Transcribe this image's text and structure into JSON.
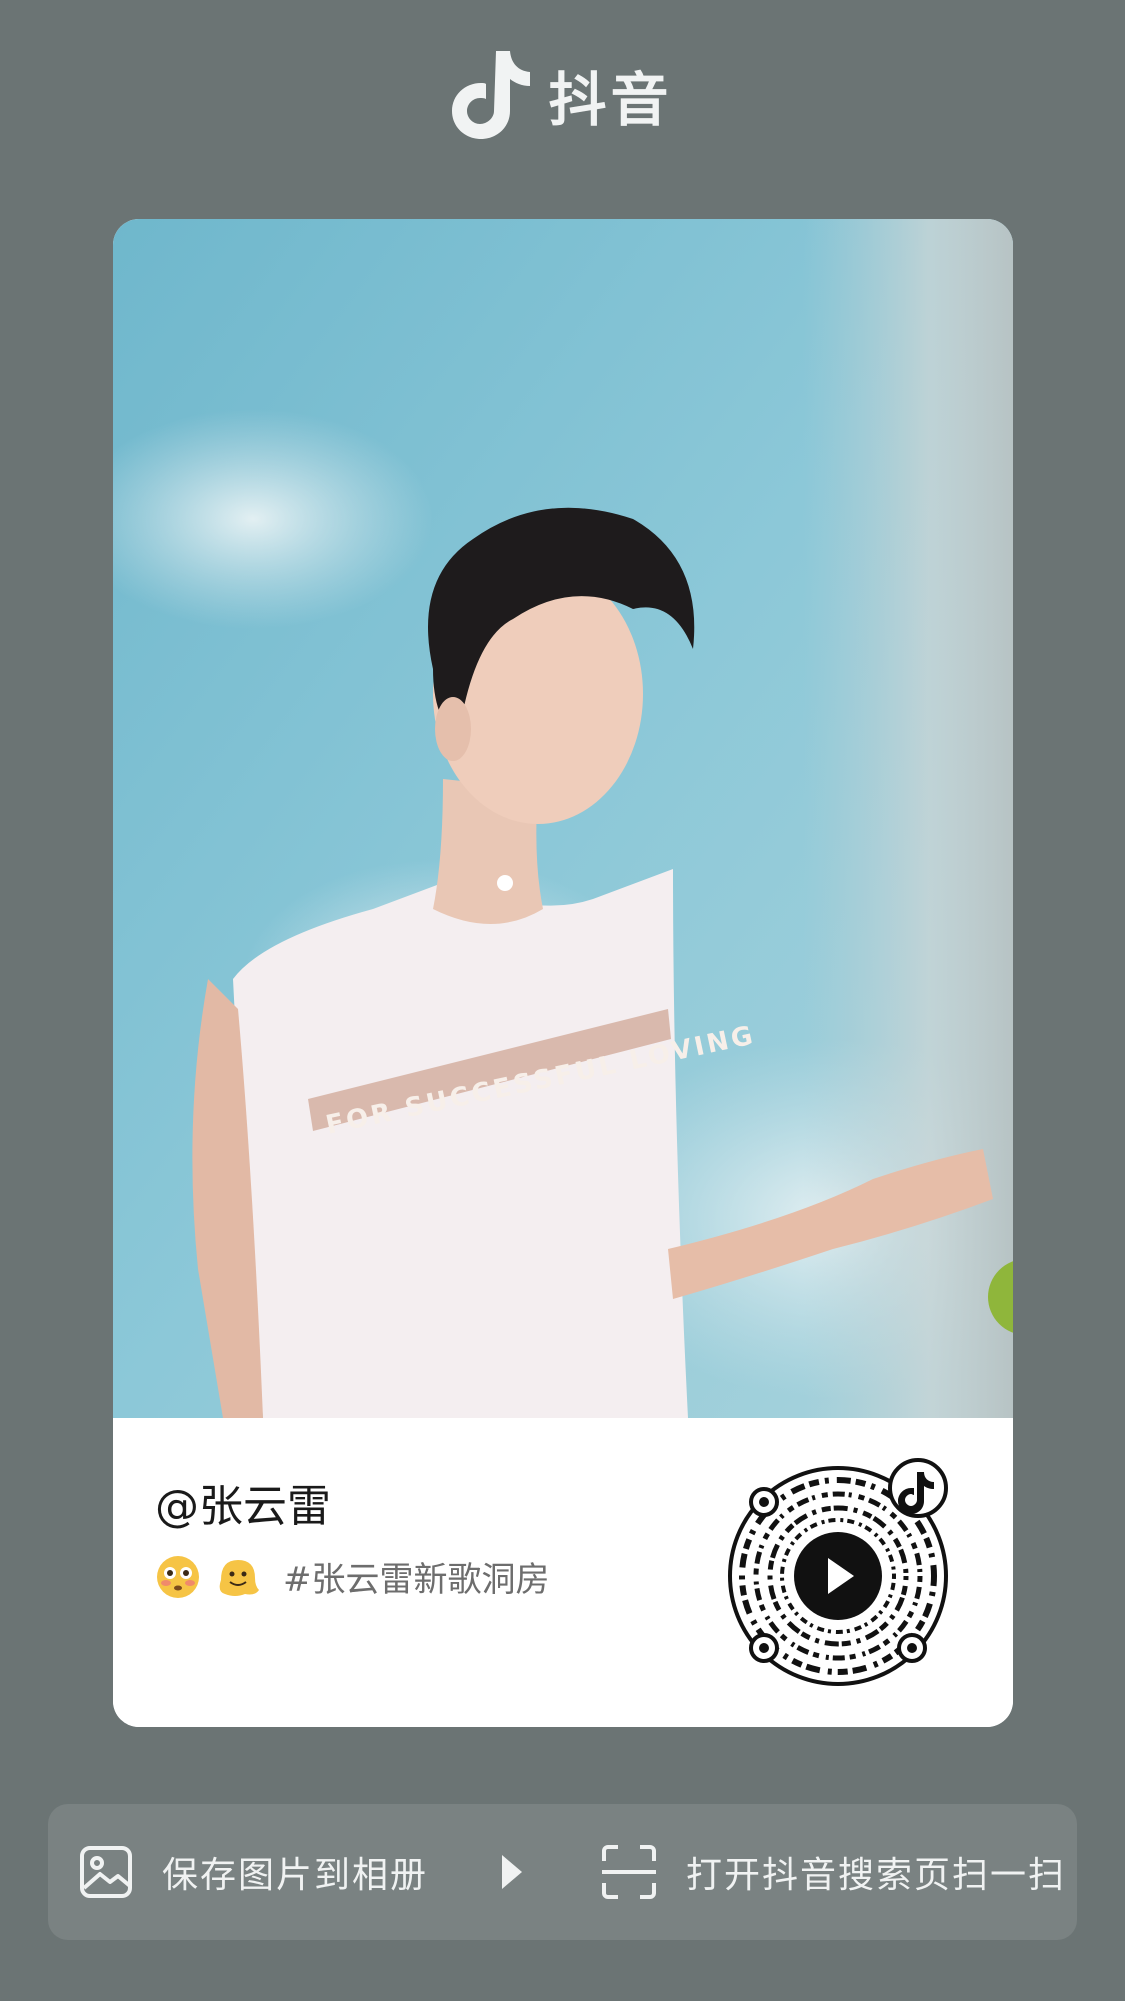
{
  "header": {
    "brand": "抖音",
    "logo_icon": "douyin-logo-icon"
  },
  "card": {
    "username": "@张云雷",
    "caption": {
      "emojis": [
        "flushed-face-emoji",
        "melting-face-emoji"
      ],
      "hashtag": "#张云雷新歌洞房"
    },
    "shirt_text": "FOR SUCCESSFUL LOVING",
    "qr_icon": "douyin-qr-code"
  },
  "actions": {
    "save_label": "保存图片到相册",
    "scan_label": "打开抖音搜索页扫一扫"
  },
  "colors": {
    "background": "#6b7474",
    "bar": "#7a8282",
    "card": "#ffffff"
  }
}
